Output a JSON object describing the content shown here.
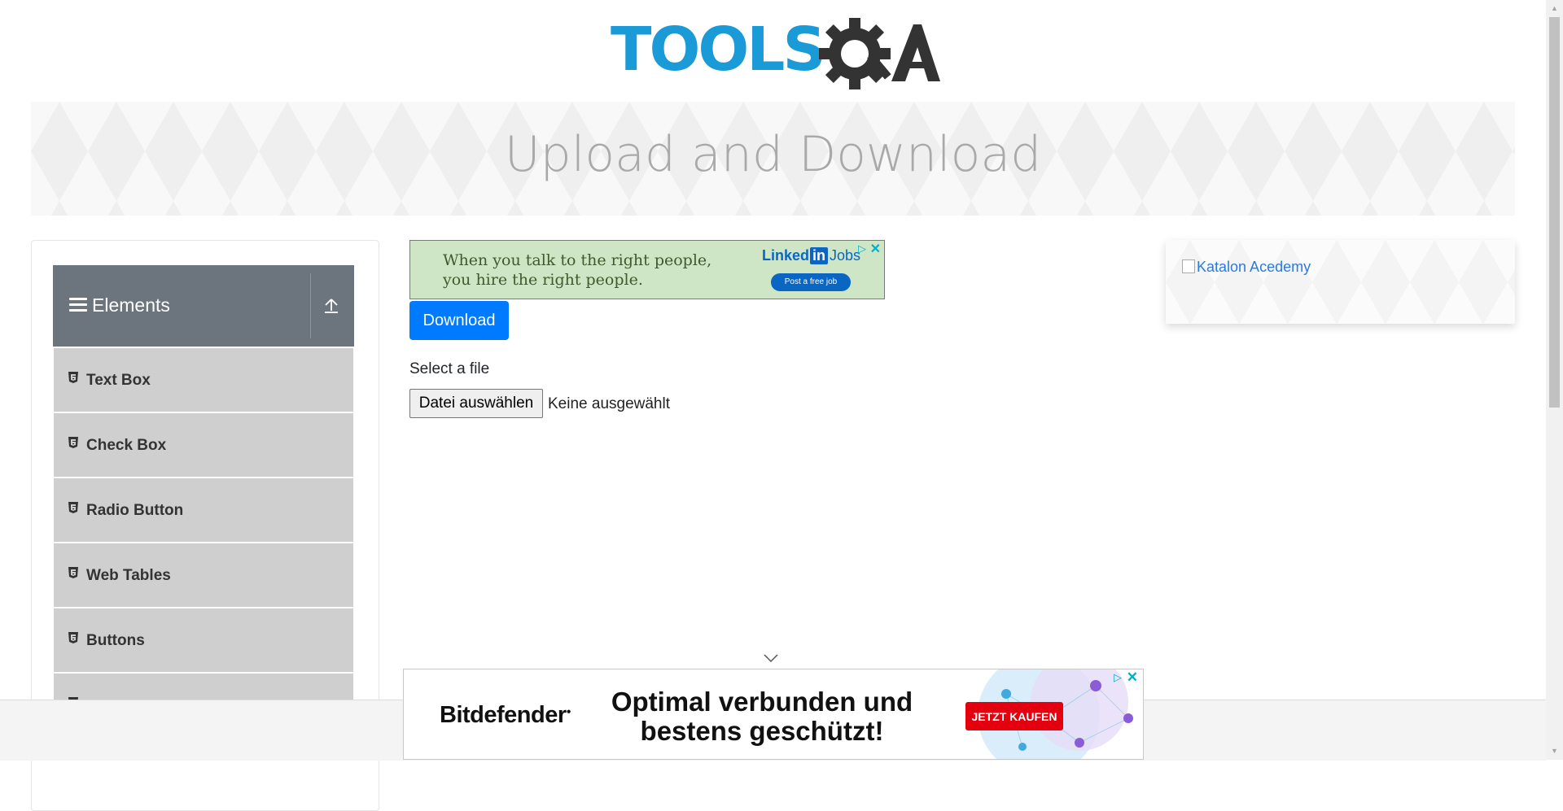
{
  "header": {
    "logo_text": "TOOLSQA"
  },
  "banner": {
    "title": "Upload and Download"
  },
  "sidebar": {
    "group_title": "Elements",
    "items": [
      {
        "label": "Text Box"
      },
      {
        "label": "Check Box"
      },
      {
        "label": "Radio Button"
      },
      {
        "label": "Web Tables"
      },
      {
        "label": "Buttons"
      },
      {
        "label": ""
      }
    ]
  },
  "ad_top": {
    "message_line1": "When you talk to the right people,",
    "message_line2": "you hire the right people.",
    "brand_linked": "Linked",
    "brand_in": "in",
    "brand_jobs": "Jobs",
    "cta": "Post a free job"
  },
  "main": {
    "download_label": "Download",
    "select_file_label": "Select a file",
    "file_button_label": "Datei auswählen",
    "file_status": "Keine ausgewählt"
  },
  "right_ad": {
    "alt_text": "Katalon Acedemy"
  },
  "ad_bottom": {
    "brand": "Bitdefender",
    "headline_line1": "Optimal verbunden und",
    "headline_line2": "bestens geschützt!",
    "cta": "JETZT KAUFEN"
  },
  "colors": {
    "accent": "#007bff",
    "logo_blue": "#1a9ad6",
    "sidebar_header": "#6c757d",
    "sidebar_item": "#cfcfcf",
    "cta_red": "#e3000f"
  }
}
